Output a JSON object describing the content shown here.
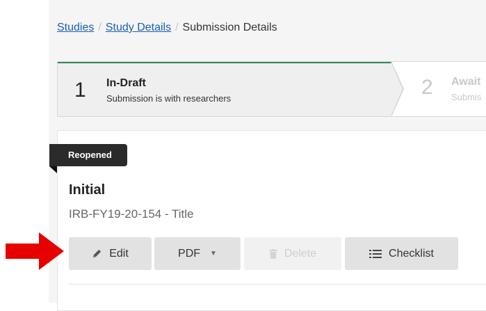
{
  "breadcrumb": {
    "items": [
      "Studies",
      "Study Details"
    ],
    "current": "Submission Details",
    "separator": "/"
  },
  "steps": [
    {
      "number": "1",
      "title": "In-Draft",
      "subtitle": "Submission is with researchers",
      "state": "active"
    },
    {
      "number": "2",
      "title": "Await",
      "subtitle": "Submis",
      "state": "upcoming"
    }
  ],
  "submission": {
    "badge": "Reopened",
    "title": "Initial",
    "record_id": "IRB-FY19-20-154 - Title"
  },
  "actions": {
    "edit_label": "Edit",
    "pdf_label": "PDF",
    "delete_label": "Delete",
    "checklist_label": "Checklist"
  },
  "icons": {
    "edit": "pencil-icon",
    "pdf": "chevron-down-icon",
    "delete": "trash-icon",
    "checklist": "list-icon",
    "annotation": "red-arrow-icon"
  },
  "colors": {
    "link": "#1a5fb4",
    "active_step_border": "#2e8b57",
    "badge_bg": "#2b2b2b",
    "annotation_arrow": "#e60000"
  }
}
